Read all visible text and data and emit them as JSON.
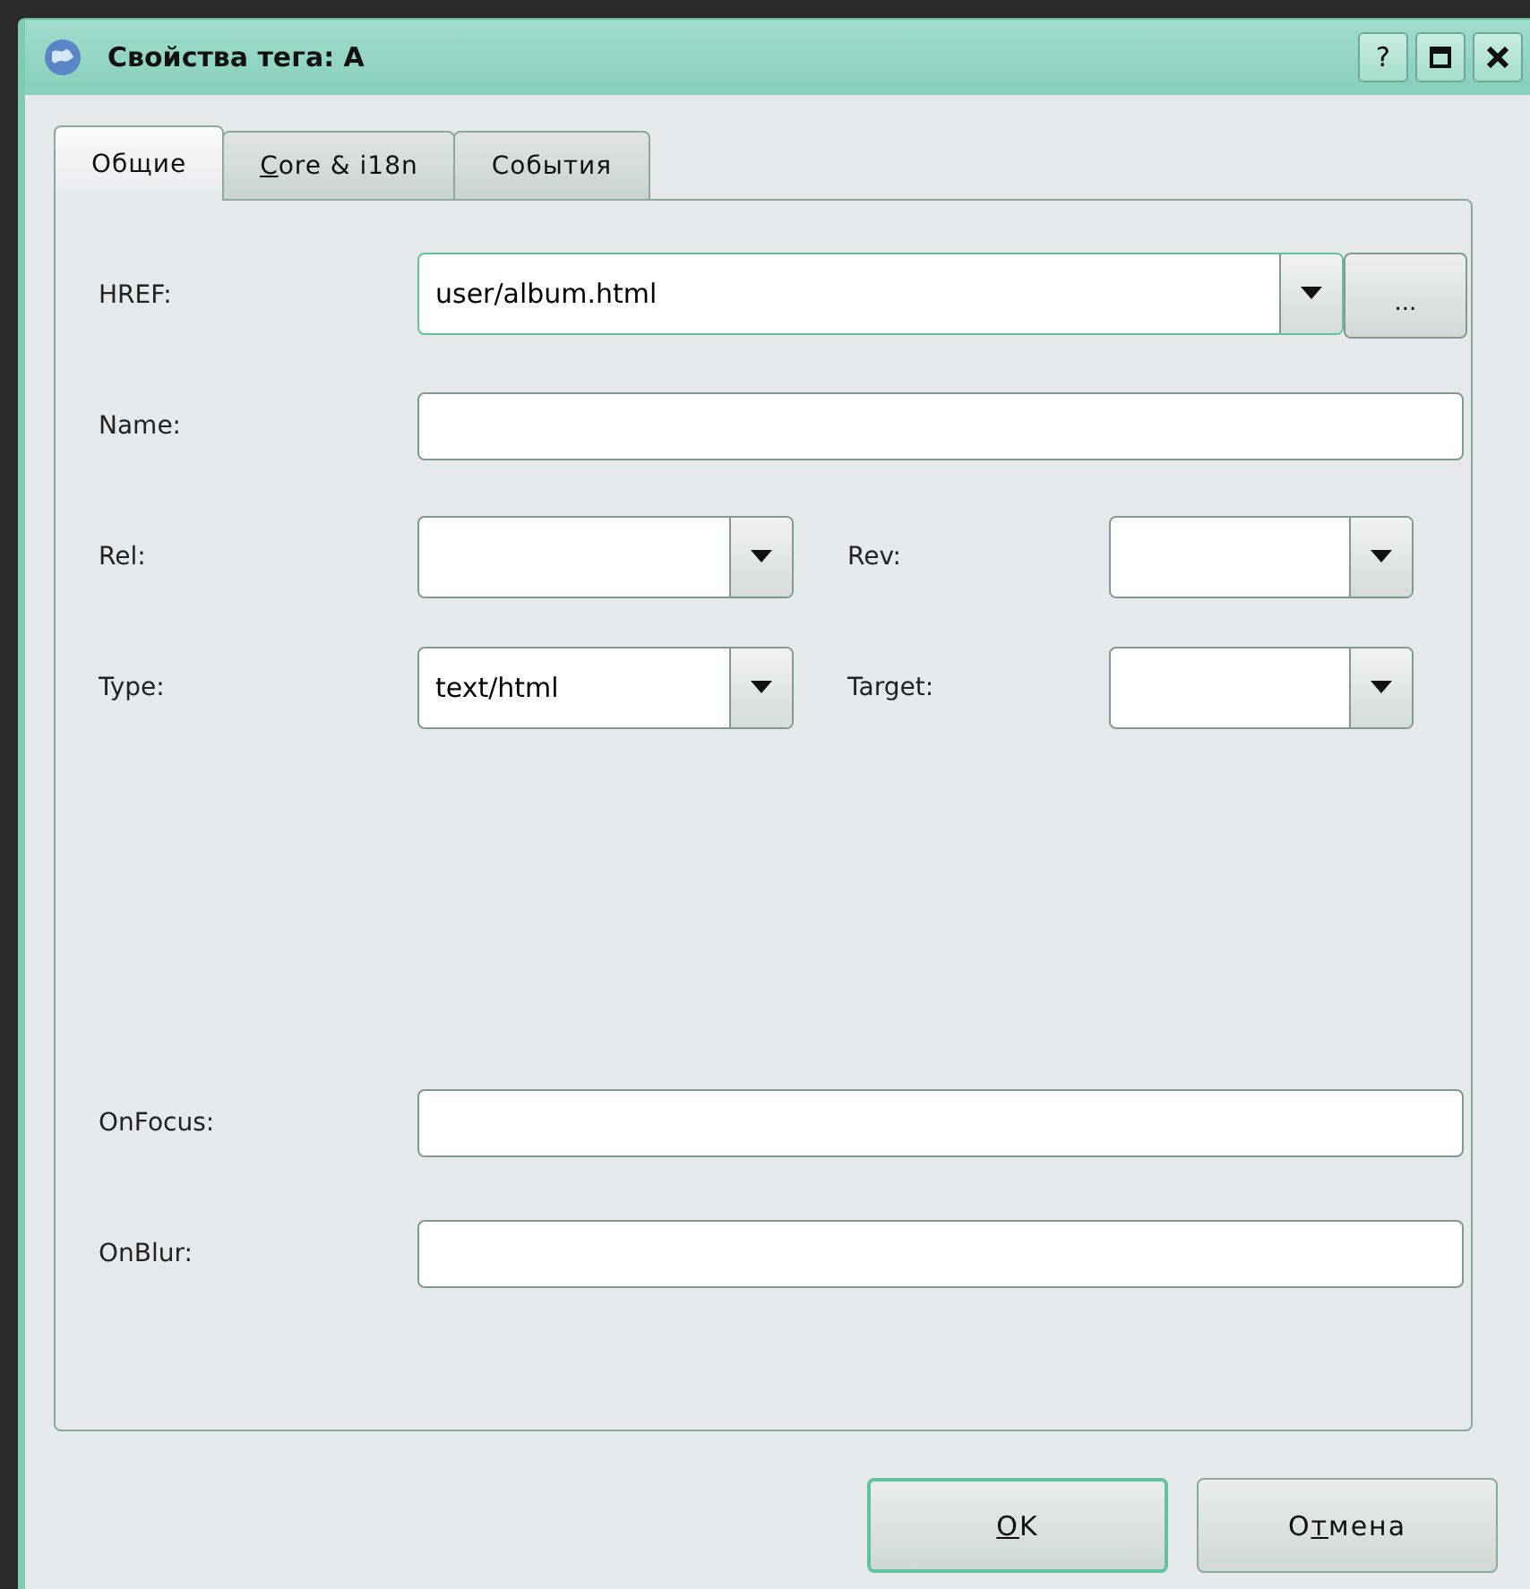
{
  "window": {
    "title": "Свойства тега: A",
    "buttons": [
      {
        "kind": "help",
        "text": "?"
      },
      {
        "kind": "maximize"
      },
      {
        "kind": "close"
      }
    ]
  },
  "tabs": [
    {
      "label": [
        {
          "text": "Общие",
          "underlined": false
        }
      ],
      "selected": true
    },
    {
      "label": [
        {
          "text": "C",
          "underlined": true
        },
        {
          "text": "ore & i18n",
          "underlined": false
        }
      ],
      "selected": false
    },
    {
      "label": [
        {
          "text": "События",
          "underlined": false
        }
      ],
      "selected": false
    }
  ],
  "href": {
    "label": "HREF:",
    "value": "user/album.html",
    "focused": true,
    "browse_button": "..."
  },
  "name": {
    "label": "Name:"
  },
  "rel": {
    "label": "Rel:"
  },
  "rev": {
    "label": "Rev:"
  },
  "type": {
    "label": "Type:",
    "value": "text/html"
  },
  "target": {
    "label": "Target:"
  },
  "onfocus": {
    "label": "OnFocus:"
  },
  "onblur": {
    "label": "OnBlur:"
  },
  "buttons": [
    {
      "label": [
        {
          "text": "O",
          "underlined": true
        },
        {
          "text": "K",
          "underlined": false
        }
      ],
      "default": true
    },
    {
      "label": [
        {
          "text": "О",
          "underlined": false
        },
        {
          "text": "т",
          "underlined": true
        },
        {
          "text": "мена",
          "underlined": false
        }
      ],
      "default": false
    }
  ]
}
